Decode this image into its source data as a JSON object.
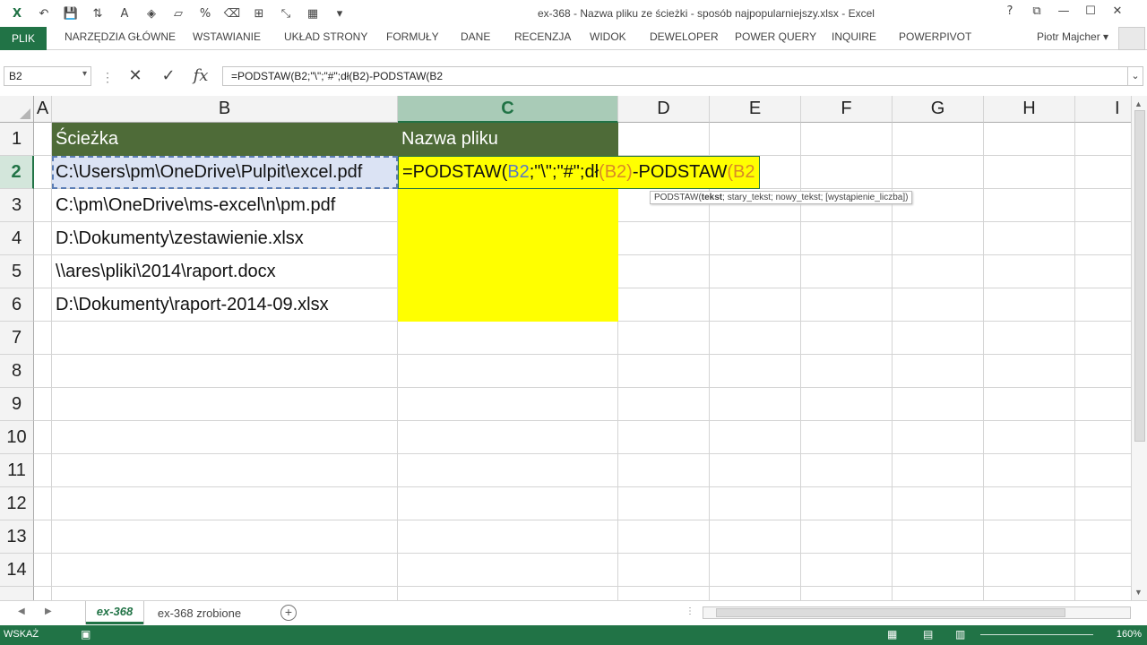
{
  "window": {
    "title": "ex-368 - Nazwa pliku ze ścieżki - sposób najpopularniejszy.xlsx - Excel",
    "controls": [
      "?",
      "⧉",
      "—",
      "☐",
      "✕"
    ]
  },
  "ribbon": {
    "tabs": [
      "PLIK",
      "NARZĘDZIA GŁÓWNE",
      "WSTAWIANIE",
      "UKŁAD STRONY",
      "FORMUŁY",
      "DANE",
      "RECENZJA",
      "WIDOK",
      "DEWELOPER",
      "POWER QUERY",
      "INQUIRE",
      "POWERPIVOT"
    ],
    "user": "Piotr Majcher ▾"
  },
  "formula_bar": {
    "name_box": "B2",
    "formula": "=PODSTAW(B2;\"\\\";\"#\";dł(B2)-PODSTAW(B2"
  },
  "columns": [
    "A",
    "B",
    "C",
    "D",
    "E",
    "F",
    "G",
    "H",
    "I"
  ],
  "rows": [
    "1",
    "2",
    "3",
    "4",
    "5",
    "6",
    "7",
    "8",
    "9",
    "10",
    "11",
    "12",
    "13",
    "14"
  ],
  "cells": {
    "B1": "Ścieżka",
    "C1": "Nazwa pliku",
    "B2": "C:\\Users\\pm\\OneDrive\\Pulpit\\excel.pdf",
    "B3": "C:\\pm\\OneDrive\\ms-excel\\n\\pm.pdf",
    "B4": "D:\\Dokumenty\\zestawienie.xlsx",
    "B5": "\\\\ares\\pliki\\2014\\raport.docx",
    "B6": "D:\\Dokumenty\\raport-2014-09.xlsx"
  },
  "editing": {
    "parts": [
      "=PODSTAW(",
      "B2",
      ";\"\\\";\"#\";dł",
      "(B2)",
      "-PODSTAW",
      "(B2"
    ],
    "tooltip_fn": "PODSTAW(",
    "tooltip_bold": "tekst",
    "tooltip_rest": "; stary_tekst; nowy_tekst; [wystąpienie_liczba])"
  },
  "sheets": {
    "tabs": [
      "ex-368",
      "ex-368 zrobione"
    ],
    "active": "ex-368"
  },
  "status": {
    "mode": "WSKAŻ",
    "zoom": "160%"
  },
  "colors": {
    "accent": "#217346",
    "header_fill": "#4e6b38",
    "highlight": "#ffff00"
  }
}
